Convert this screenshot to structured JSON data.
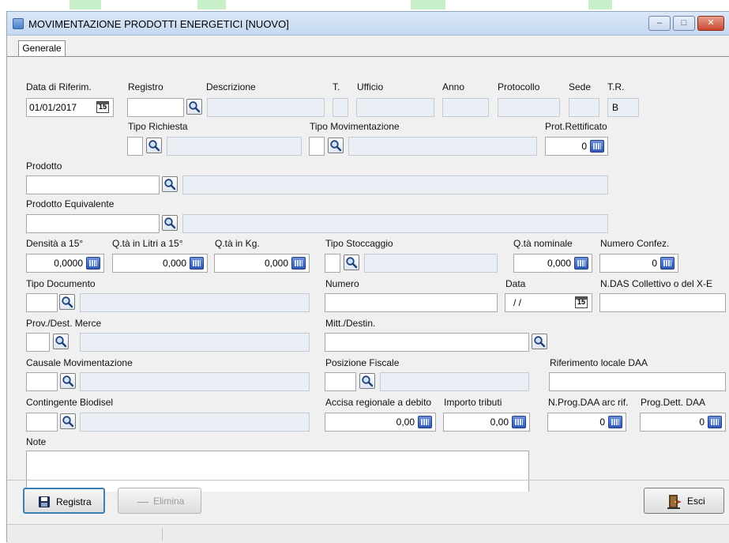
{
  "window": {
    "title": "MOVIMENTAZIONE PRODOTTI ENERGETICI  [NUOVO]",
    "minimize": "–",
    "maximize": "□",
    "close": "✕"
  },
  "tab": {
    "label": "Generale"
  },
  "labels": {
    "data_riferim": "Data di Riferim.",
    "registro": "Registro",
    "descrizione": "Descrizione",
    "t": "T.",
    "ufficio": "Ufficio",
    "anno": "Anno",
    "protocollo": "Protocollo",
    "sede": "Sede",
    "tr": "T.R.",
    "tipo_richiesta": "Tipo Richiesta",
    "tipo_movimentazione": "Tipo Movimentazione",
    "prot_rettificato": "Prot.Rettificato",
    "prodotto": "Prodotto",
    "prodotto_equivalente": "Prodotto Equivalente",
    "densita": "Densità a 15°",
    "qta_litri": "Q.tà in Litri a 15°",
    "qta_kg": "Q.tà in Kg.",
    "tipo_stoccaggio": "Tipo Stoccaggio",
    "qta_nominale": "Q.tà nominale",
    "numero_confez": "Numero Confez.",
    "tipo_documento": "Tipo Documento",
    "numero": "Numero",
    "data": "Data",
    "n_das": "N.DAS Collettivo o del X-E",
    "prov_dest": "Prov./Dest. Merce",
    "mitt_destin": "Mitt./Destin.",
    "causale": "Causale Movimentazione",
    "posizione_fiscale": "Posizione Fiscale",
    "riferimento_locale": "Riferimento locale DAA",
    "contingente": "Contingente Biodisel",
    "accisa": "Accisa regionale a debito",
    "importo_tributi": "Importo tributi",
    "nprog_daa": "N.Prog.DAA arc rif.",
    "prog_dett": "Prog.Dett. DAA",
    "note": "Note"
  },
  "values": {
    "data_riferim": "01/01/2017",
    "tr": "B",
    "prot_rettificato": "0",
    "densita": "0,0000",
    "qta_litri": "0,000",
    "qta_kg": "0,000",
    "qta_nominale": "0,000",
    "numero_confez": "0",
    "data": "/ /",
    "accisa": "0,00",
    "importo_tributi": "0,00",
    "nprog_daa": "0",
    "prog_dett": "0",
    "calendar_glyph": "15"
  },
  "buttons": {
    "registra": "Registra",
    "elimina": "Elimina",
    "esci": "Esci"
  }
}
